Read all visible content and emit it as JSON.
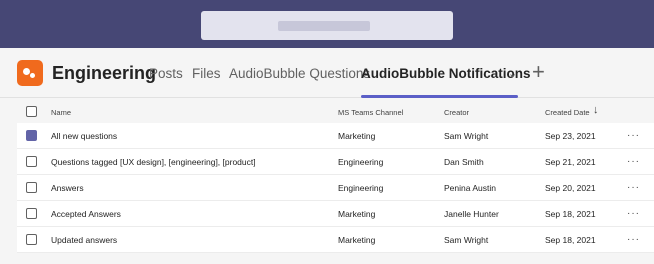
{
  "team": {
    "name": "Engineering"
  },
  "tabs": [
    {
      "label": "Posts"
    },
    {
      "label": "Files"
    },
    {
      "label": "AudioBubble Questions"
    },
    {
      "label": "AudioBubble Notifications"
    }
  ],
  "table": {
    "columns": {
      "name": "Name",
      "channel": "MS Teams Channel",
      "creator": "Creator",
      "created": "Created Date"
    },
    "sort": {
      "column": "Created Date",
      "direction": "descending"
    },
    "rows": [
      {
        "name": "All new questions",
        "channel": "Marketing",
        "creator": "Sam Wright",
        "created": "Sep 23, 2021",
        "more": "···",
        "checked": true
      },
      {
        "name": "Questions tagged [UX design], [engineering], [product]",
        "channel": "Engineering",
        "creator": "Dan Smith",
        "created": "Sep 21, 2021",
        "more": "···",
        "checked": false
      },
      {
        "name": "Answers",
        "channel": "Engineering",
        "creator": "Penina Austin",
        "created": "Sep 20, 2021",
        "more": "···",
        "checked": false
      },
      {
        "name": "Accepted Answers",
        "channel": "Marketing",
        "creator": "Janelle Hunter",
        "created": "Sep 18, 2021",
        "more": "···",
        "checked": false
      },
      {
        "name": "Updated answers",
        "channel": "Marketing",
        "creator": "Sam Wright",
        "created": "Sep 18, 2021",
        "more": "···",
        "checked": false
      }
    ]
  },
  "icons": {
    "search": "search-bar",
    "team": "team-icon",
    "dropdown": "chevron-down-icon",
    "add": "plus-icon",
    "sort": "arrow-down-icon",
    "more": "more-options-icon"
  },
  "colors": {
    "topbar": "#464775",
    "accent": "#5b5fc7",
    "team_icon": "#f06a1d",
    "checked": "#6264a7"
  }
}
